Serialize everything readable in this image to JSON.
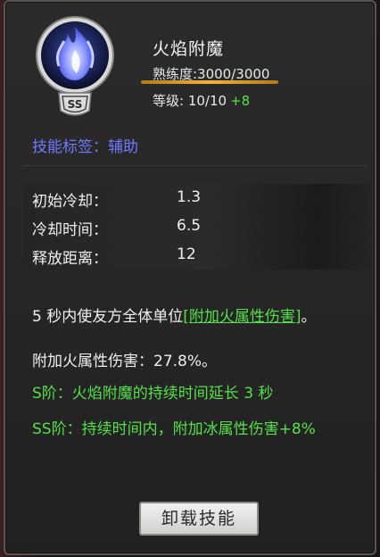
{
  "skill": {
    "name": "火焰附魔",
    "proficiency": "熟练度:3000/3000",
    "level": "等级: 10/10",
    "level_bonus": "+8",
    "rank_badge": "SS",
    "icon": "blue-flame-icon"
  },
  "tag_line": "技能标签：辅助",
  "stats": [
    {
      "label": "初始冷却：",
      "value": "1.3"
    },
    {
      "label": "冷却时间：",
      "value": "6.5"
    },
    {
      "label": "释放距离：",
      "value": "12"
    }
  ],
  "description": {
    "line1_pre": "5 秒内使友方全体单位",
    "line1_link": "[附加火属性伤害]",
    "line1_post": "。",
    "line2": "附加火属性伤害：27.8%。",
    "s_rank": "S阶：火焰附魔的持续时间延长 3 秒",
    "ss_rank": "SS阶：持续时间内，附加冰属性伤害+8%"
  },
  "unequip_button": "卸载技能",
  "colors": {
    "green": "#55e04a",
    "tag_blue": "#6f79ff",
    "proficiency_bar": "#f0b33a",
    "panel_bg": "#2a2929"
  }
}
